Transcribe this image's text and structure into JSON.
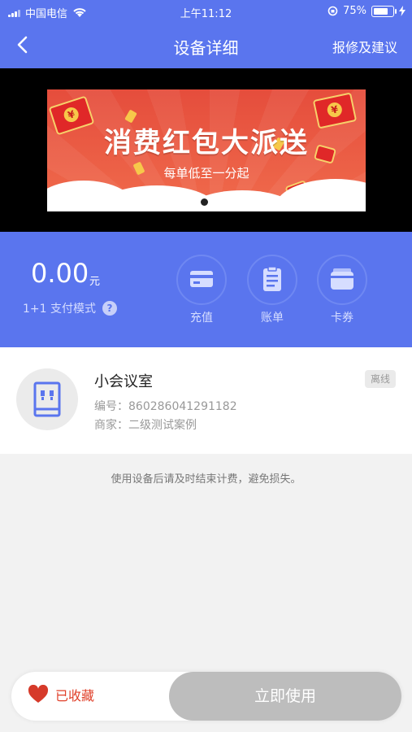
{
  "status_bar": {
    "carrier": "中国电信",
    "time": "上午11:12",
    "battery": "75%",
    "battery_level": 0.75
  },
  "nav": {
    "title": "设备详细",
    "right_action": "报修及建议",
    "back_icon": "chevron-left-icon"
  },
  "banner": {
    "headline": "消费红包大派送",
    "subline": "每单低至一分起"
  },
  "wallet": {
    "amount": "0.00",
    "unit": "元",
    "pay_mode": "1+1 支付模式",
    "help_icon": "?",
    "actions": [
      {
        "label": "充值",
        "icon": "card-icon"
      },
      {
        "label": "账单",
        "icon": "bill-icon"
      },
      {
        "label": "卡券",
        "icon": "wallet-icon"
      }
    ]
  },
  "device": {
    "name": "小会议室",
    "status": "离线",
    "serial": "编号：860286041291182",
    "merchant": "商家：二级测试案例",
    "icon": "dispenser-icon"
  },
  "notice": "使用设备后请及时结束计费，避免损失。",
  "bottom": {
    "favorite_label": "已收藏",
    "use_label": "立即使用"
  },
  "colors": {
    "primary": "#5a75ee",
    "favorite": "#e0402a",
    "disabled": "#bdbdbd"
  }
}
